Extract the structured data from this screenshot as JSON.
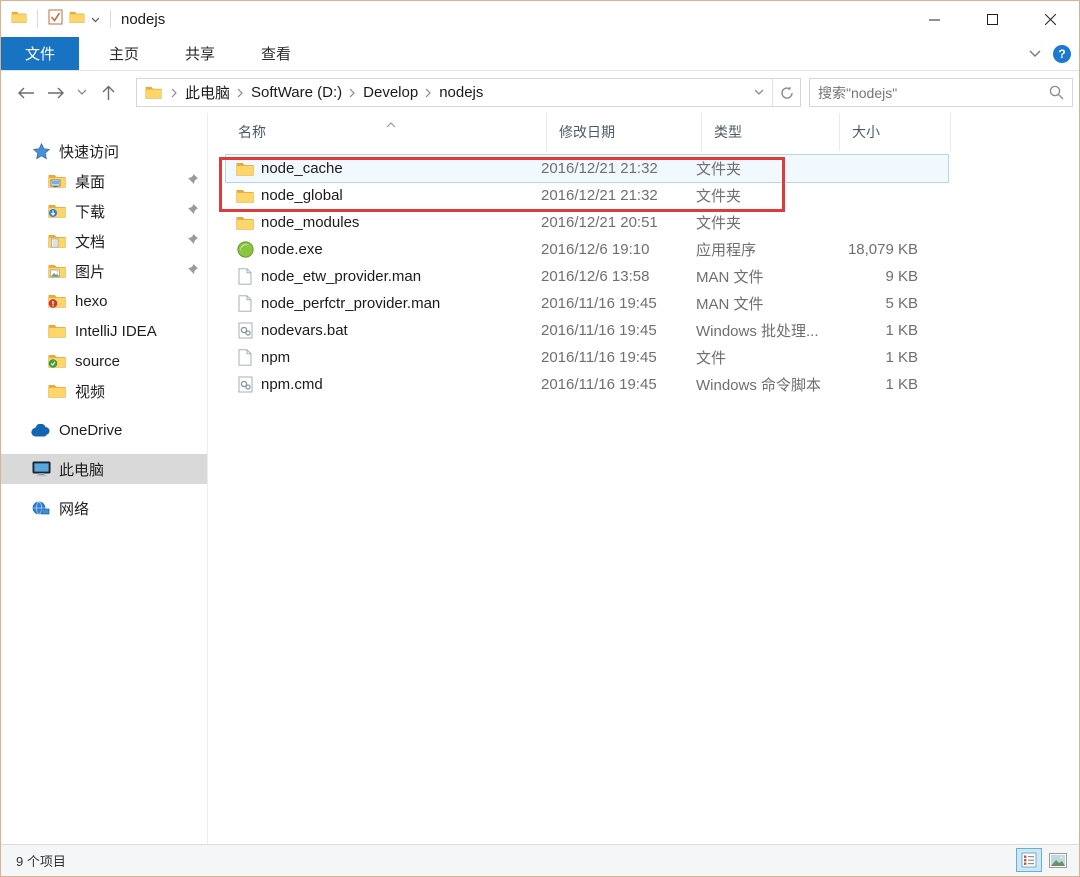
{
  "window": {
    "title": "nodejs"
  },
  "titlebar_icons": [
    "folder-icon",
    "checkbox-icon",
    "folder-icon",
    "chevron-down-icon"
  ],
  "ribbon": {
    "tabs": [
      {
        "label": "文件",
        "active": true
      },
      {
        "label": "主页",
        "active": false
      },
      {
        "label": "共享",
        "active": false
      },
      {
        "label": "查看",
        "active": false
      }
    ]
  },
  "nav": {
    "breadcrumb": [
      "此电脑",
      "SoftWare (D:)",
      "Develop",
      "nodejs"
    ],
    "search_placeholder": "搜索\"nodejs\""
  },
  "sidebar": {
    "items": [
      {
        "label": "快速访问",
        "icon": "quick-access-star",
        "level": 1,
        "pinned": false,
        "gap": false,
        "selected": false
      },
      {
        "label": "桌面",
        "icon": "folder-desktop",
        "level": 2,
        "pinned": true,
        "gap": false,
        "selected": false
      },
      {
        "label": "下载",
        "icon": "folder-download",
        "level": 2,
        "pinned": true,
        "gap": false,
        "selected": false
      },
      {
        "label": "文档",
        "icon": "folder-documents",
        "level": 2,
        "pinned": true,
        "gap": false,
        "selected": false
      },
      {
        "label": "图片",
        "icon": "folder-pictures",
        "level": 2,
        "pinned": true,
        "gap": false,
        "selected": false
      },
      {
        "label": "hexo",
        "icon": "folder-svn-modified",
        "level": 2,
        "pinned": false,
        "gap": false,
        "selected": false
      },
      {
        "label": "IntelliJ IDEA",
        "icon": "folder",
        "level": 2,
        "pinned": false,
        "gap": false,
        "selected": false
      },
      {
        "label": "source",
        "icon": "folder-svn-ok",
        "level": 2,
        "pinned": false,
        "gap": false,
        "selected": false
      },
      {
        "label": "视频",
        "icon": "folder",
        "level": 2,
        "pinned": false,
        "gap": false,
        "selected": false
      },
      {
        "label": "OneDrive",
        "icon": "onedrive-cloud",
        "level": 1,
        "pinned": false,
        "gap": true,
        "selected": false
      },
      {
        "label": "此电脑",
        "icon": "this-pc",
        "level": 1,
        "pinned": false,
        "gap": true,
        "selected": true
      },
      {
        "label": "网络",
        "icon": "network",
        "level": 1,
        "pinned": false,
        "gap": true,
        "selected": false
      }
    ]
  },
  "files": {
    "columns": [
      "名称",
      "修改日期",
      "类型",
      "大小"
    ],
    "rows": [
      {
        "name": "node_cache",
        "date": "2016/12/21 21:32",
        "type": "文件夹",
        "size": "",
        "icon": "folder",
        "selected": true
      },
      {
        "name": "node_global",
        "date": "2016/12/21 21:32",
        "type": "文件夹",
        "size": "",
        "icon": "folder",
        "selected": false
      },
      {
        "name": "node_modules",
        "date": "2016/12/21 20:51",
        "type": "文件夹",
        "size": "",
        "icon": "folder",
        "selected": false
      },
      {
        "name": "node.exe",
        "date": "2016/12/6 19:10",
        "type": "应用程序",
        "size": "18,079 KB",
        "icon": "node-app",
        "selected": false
      },
      {
        "name": "node_etw_provider.man",
        "date": "2016/12/6 13:58",
        "type": "MAN 文件",
        "size": "9 KB",
        "icon": "file",
        "selected": false
      },
      {
        "name": "node_perfctr_provider.man",
        "date": "2016/11/16 19:45",
        "type": "MAN 文件",
        "size": "5 KB",
        "icon": "file",
        "selected": false
      },
      {
        "name": "nodevars.bat",
        "date": "2016/11/16 19:45",
        "type": "Windows 批处理...",
        "size": "1 KB",
        "icon": "file-script",
        "selected": false
      },
      {
        "name": "npm",
        "date": "2016/11/16 19:45",
        "type": "文件",
        "size": "1 KB",
        "icon": "file",
        "selected": false
      },
      {
        "name": "npm.cmd",
        "date": "2016/11/16 19:45",
        "type": "Windows 命令脚本",
        "size": "1 KB",
        "icon": "file-script",
        "selected": false
      }
    ]
  },
  "statusbar": {
    "count_label": "9 个项目"
  },
  "colors": {
    "accent_blue": "#1873c2",
    "highlight_red": "#de3b3b",
    "selection_border": "#b8d6ea",
    "selection_bg": "#f2f9fe",
    "sidebar_selected_bg": "#d9d9d9"
  }
}
